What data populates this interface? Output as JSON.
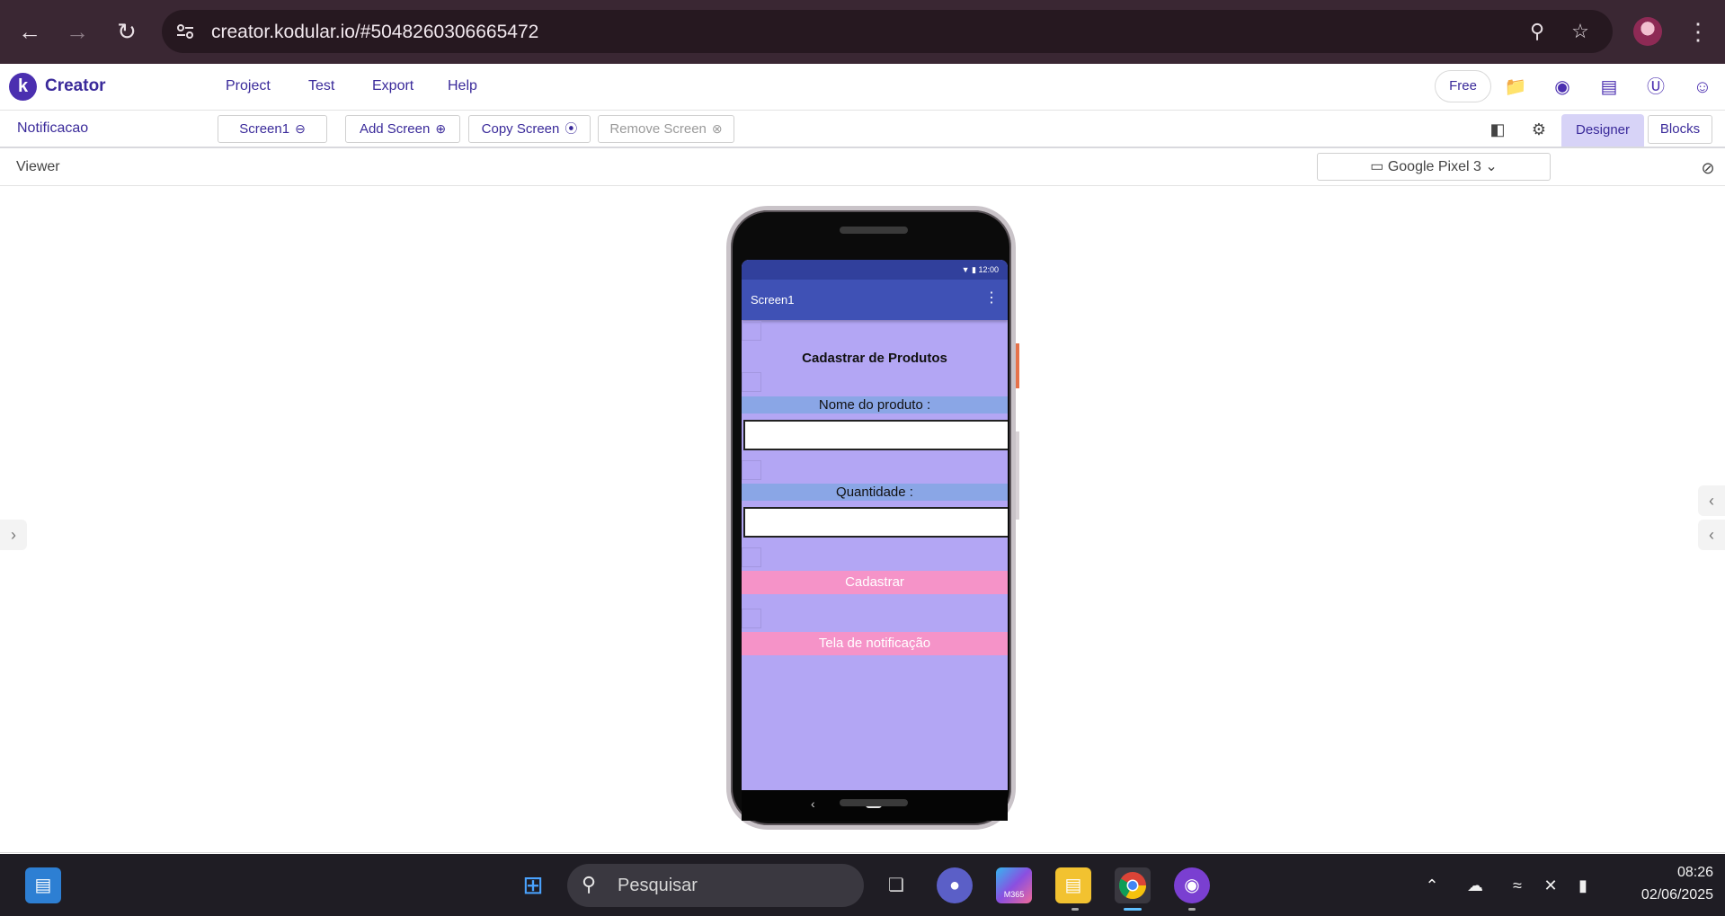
{
  "browser": {
    "url": "creator.kodular.io/#5048260306665472"
  },
  "app": {
    "logo_letter": "k",
    "name": "Creator",
    "menu": [
      "Project",
      "Test",
      "Export",
      "Help"
    ],
    "plan_badge": "Free",
    "header_icons": [
      "folder-star-icon",
      "palette-icon",
      "library-icon",
      "dollar-icon",
      "account-icon"
    ]
  },
  "toolbar": {
    "project_name": "Notificacao",
    "screen_select": "Screen1",
    "add_screen": "Add Screen",
    "copy_screen": "Copy Screen",
    "remove_screen": "Remove Screen",
    "designer": "Designer",
    "blocks": "Blocks"
  },
  "viewer": {
    "label": "Viewer",
    "device": "Google Pixel 3"
  },
  "phone": {
    "status_time": "12:00",
    "app_title": "Screen1",
    "heading": "Cadastrar de Produtos",
    "label_name": "Nome do produto :",
    "label_qty": "Quantidade :",
    "btn_register": "Cadastrar",
    "btn_notification": "Tela de notificação",
    "colors": {
      "background": "#b3a6f4",
      "app_bar": "#3f51b5",
      "label_bg": "#8aa6e6",
      "button_bg": "#f593c8"
    }
  },
  "taskbar": {
    "search_placeholder": "Pesquisar",
    "time": "08:26",
    "date": "02/06/2025",
    "m365_label": "M365"
  }
}
